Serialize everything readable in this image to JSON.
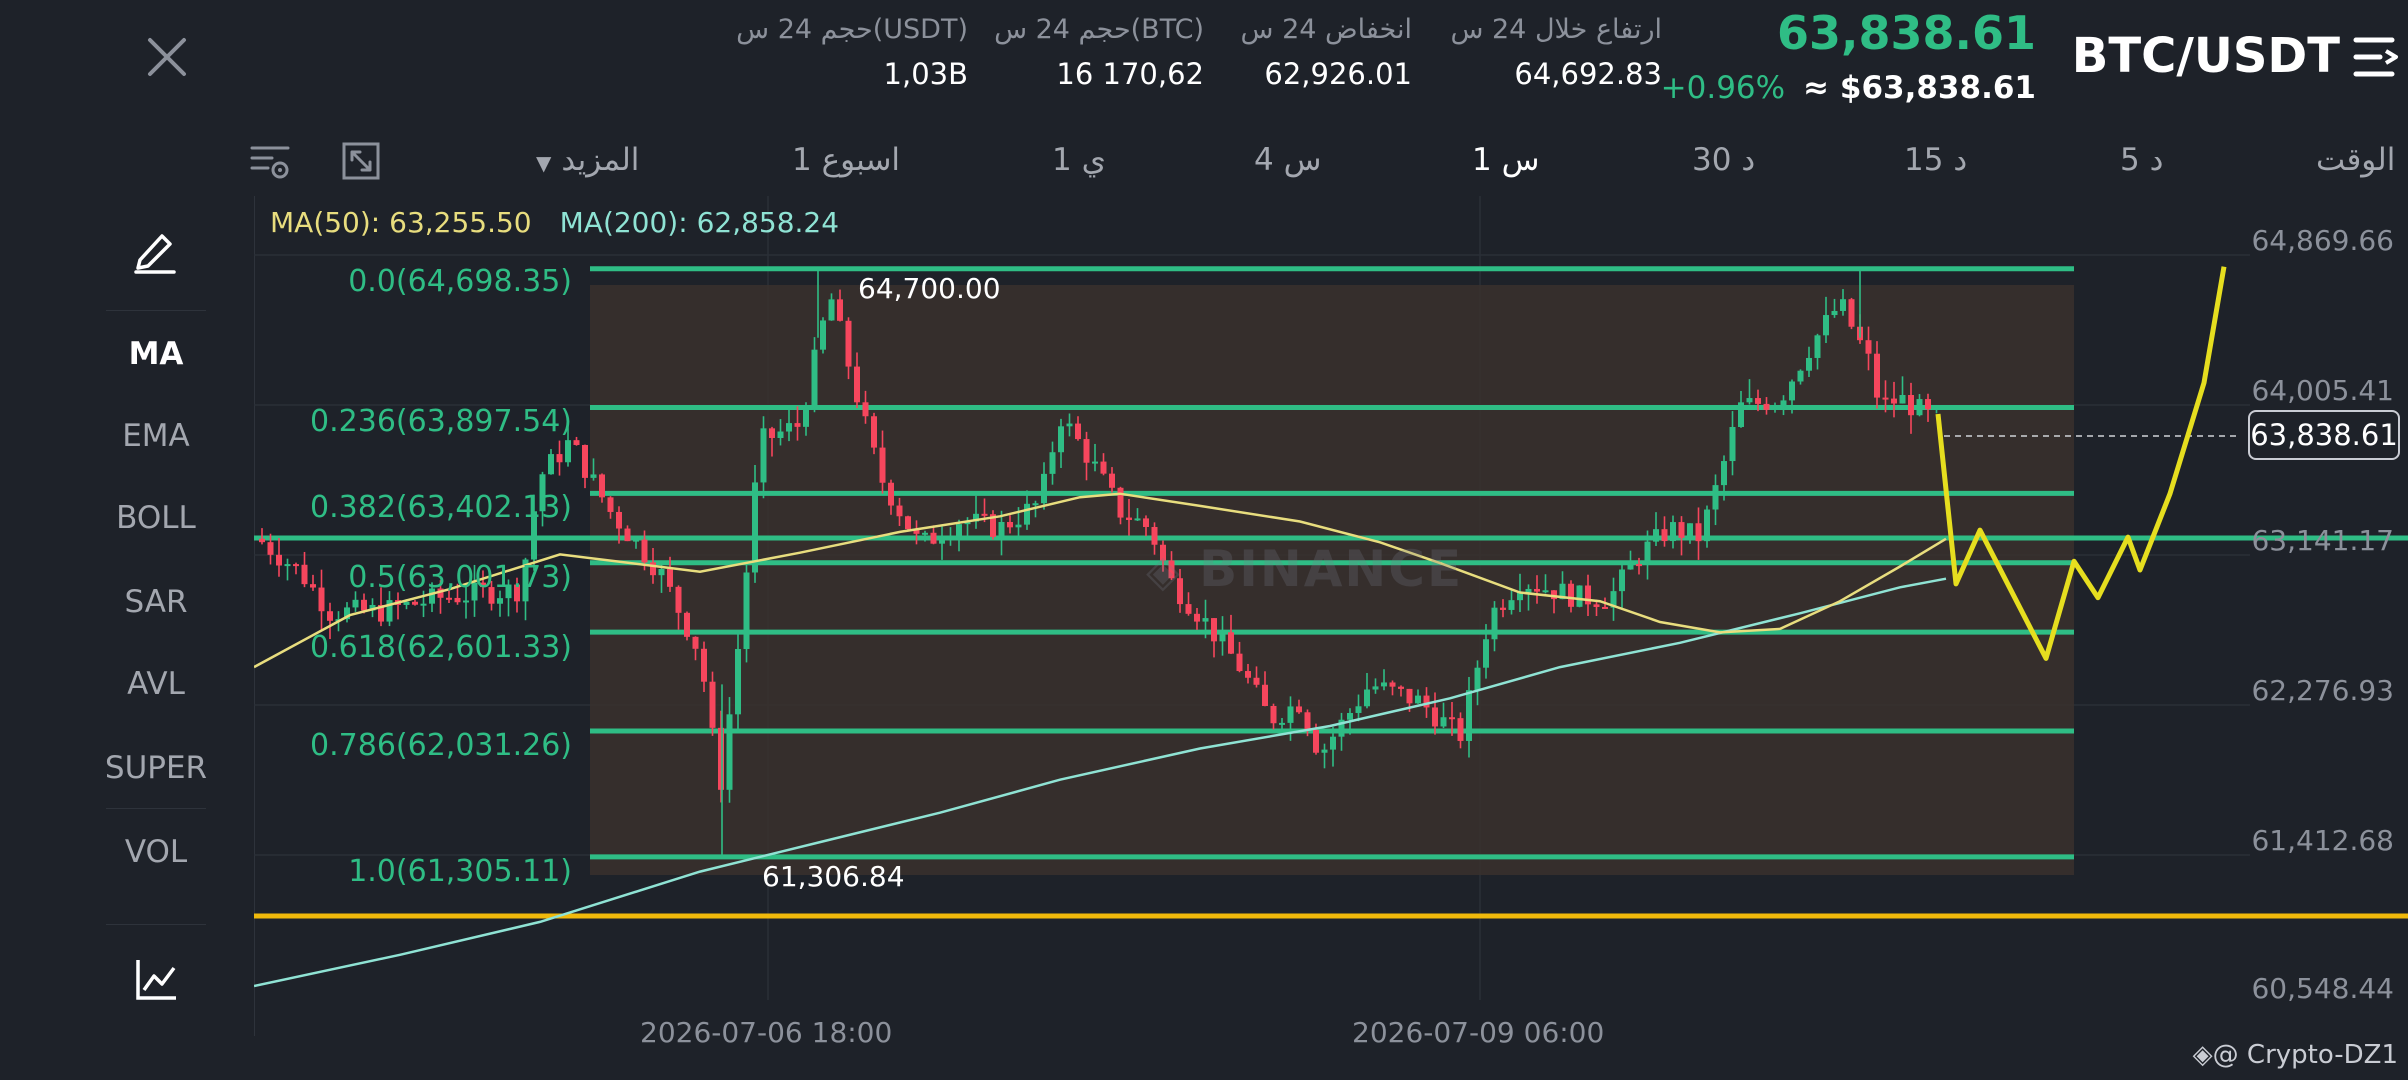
{
  "header": {
    "pair": "BTC/USDT",
    "last_price": "63,838.61",
    "change_pct": "+0.96%",
    "usd_price": "≈ $63,838.61",
    "stats": [
      {
        "label": "ارتفاع خلال 24 س",
        "value": "64,692.83"
      },
      {
        "label": "انخفاض 24 س",
        "value": "62,926.01"
      },
      {
        "label": "حجم 24 س(BTC)",
        "value": "16 170,62"
      },
      {
        "label": "حجم 24 س(USDT)",
        "value": "1,03B"
      }
    ]
  },
  "timeframes": {
    "label": "الوقت",
    "items": [
      "5 د",
      "15 د",
      "30 د",
      "1 س",
      "4 س",
      "1 ي",
      "1 اسبوع",
      "المزيد"
    ],
    "active": "1 س"
  },
  "sidebar": {
    "items": [
      "MA",
      "EMA",
      "BOLL",
      "SAR",
      "AVL",
      "SUPER",
      "VOL"
    ],
    "active": "MA"
  },
  "indicators": {
    "ma50": "MA(50): 63,255.50",
    "ma200": "MA(200): 62,858.24"
  },
  "price_axis": [
    "64,869.66",
    "64,005.41",
    "63,141.17",
    "62,276.93",
    "61,412.68",
    "60,548.44"
  ],
  "current_price_tag": "63,838.61",
  "fib_levels": [
    {
      "label": "0.0(64,698.35)",
      "price": 64698.35
    },
    {
      "label": "0.236(63,897.54)",
      "price": 63897.54
    },
    {
      "label": "0.382(63,402.13)",
      "price": 63402.13
    },
    {
      "label": "0.5(63,001.73)",
      "price": 63001.73
    },
    {
      "label": "0.618(62,601.33)",
      "price": 62601.33
    },
    {
      "label": "0.786(62,031.26)",
      "price": 62031.26
    },
    {
      "label": "1.0(61,305.11)",
      "price": 61305.11
    }
  ],
  "chart_high_label": "64,700.00",
  "chart_low_label": "61,306.84",
  "date_labels": [
    "2026-07-06 18:00",
    "2026-07-09 06:00"
  ],
  "watermark": "BINANCE",
  "credit": "@ Crypto-DZ1",
  "colors": {
    "up": "#2fbd85",
    "down": "#f6465d",
    "ma50": "#e8dd7e",
    "ma200": "#8fe3d4",
    "fib": "#2fbd85",
    "support": "#f0b90b",
    "projection": "#e6de1f"
  }
}
